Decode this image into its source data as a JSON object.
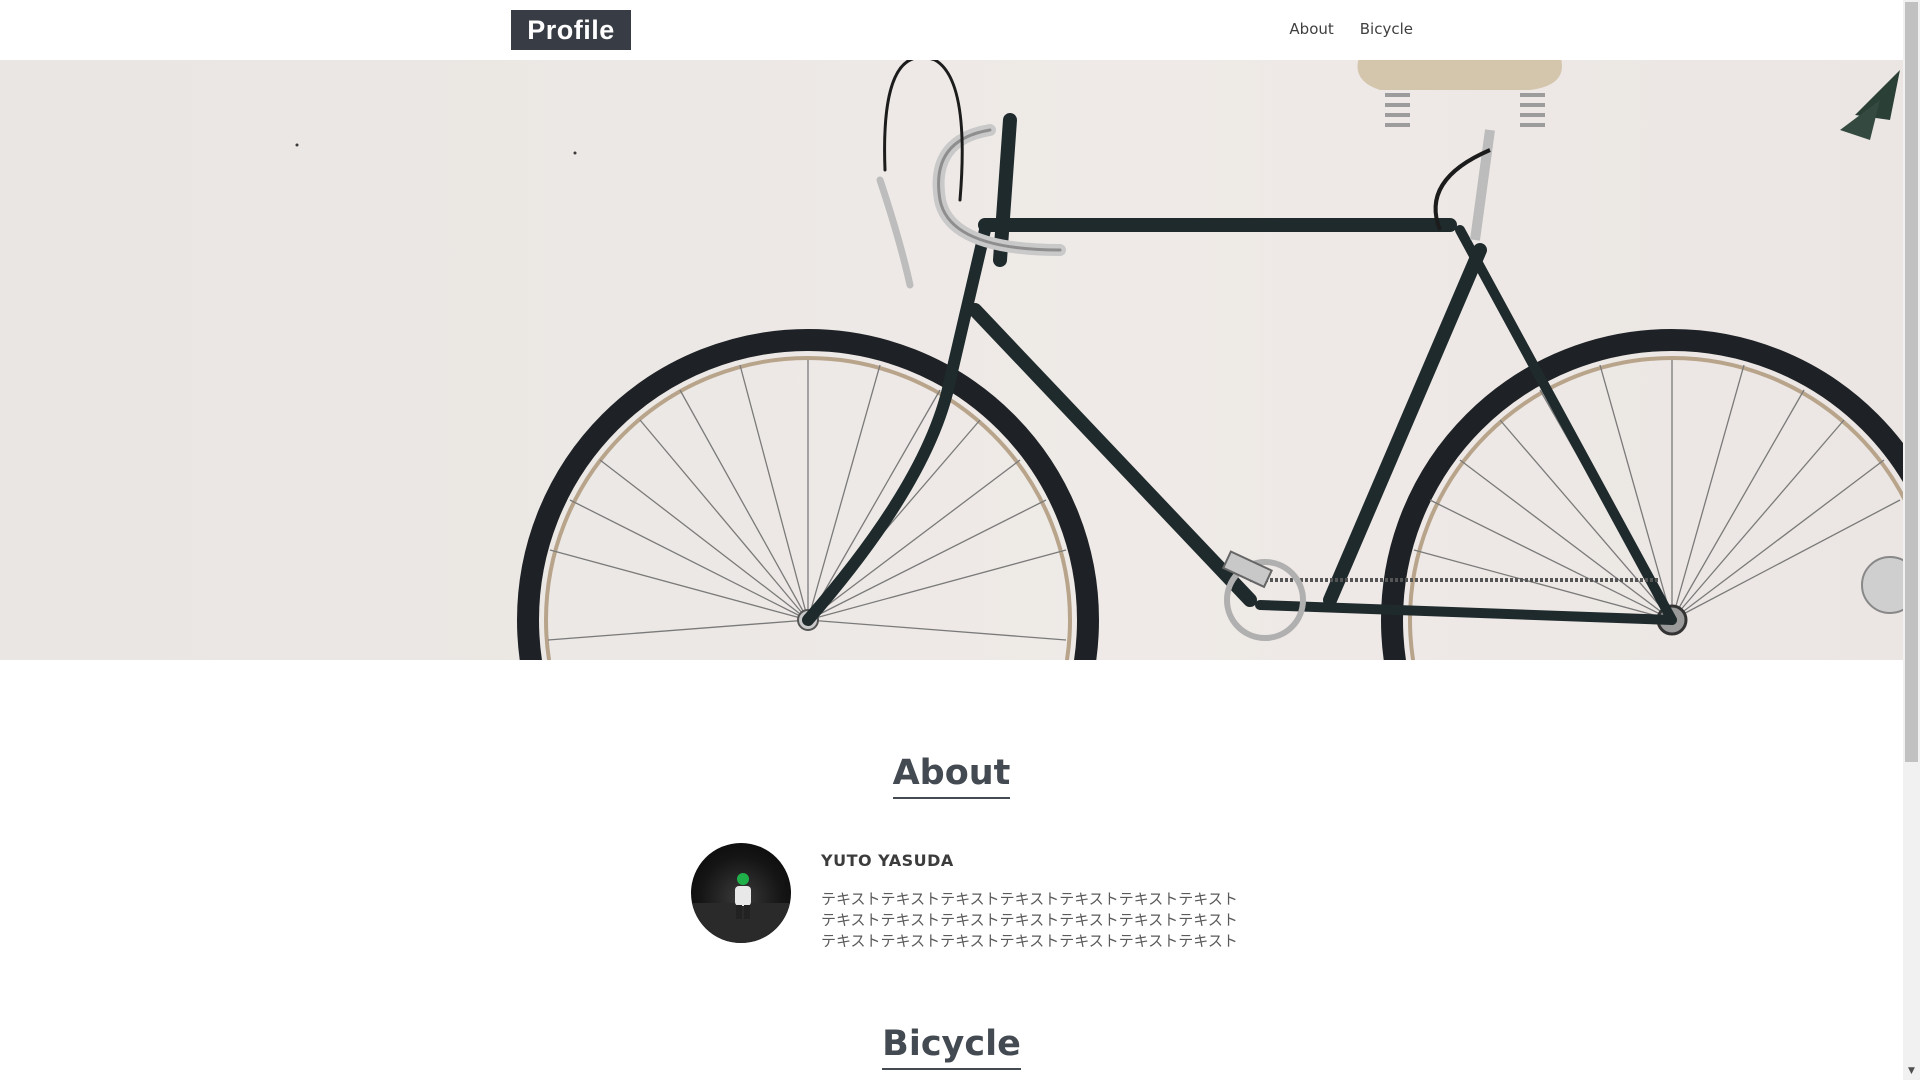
{
  "header": {
    "logo_text": "Profile",
    "nav": [
      {
        "label": "About"
      },
      {
        "label": "Bicycle"
      }
    ]
  },
  "hero": {
    "image": "bicycle-photo"
  },
  "about": {
    "title": "About",
    "name": "YUTO YASUDA",
    "text_lines": [
      "テキストテキストテキストテキストテキストテキストテキスト",
      "テキストテキストテキストテキストテキストテキストテキスト",
      "テキストテキストテキストテキストテキストテキストテキスト"
    ]
  },
  "bicycle": {
    "title": "Bicycle"
  },
  "scrollbar": {
    "down_arrow": "▼"
  }
}
